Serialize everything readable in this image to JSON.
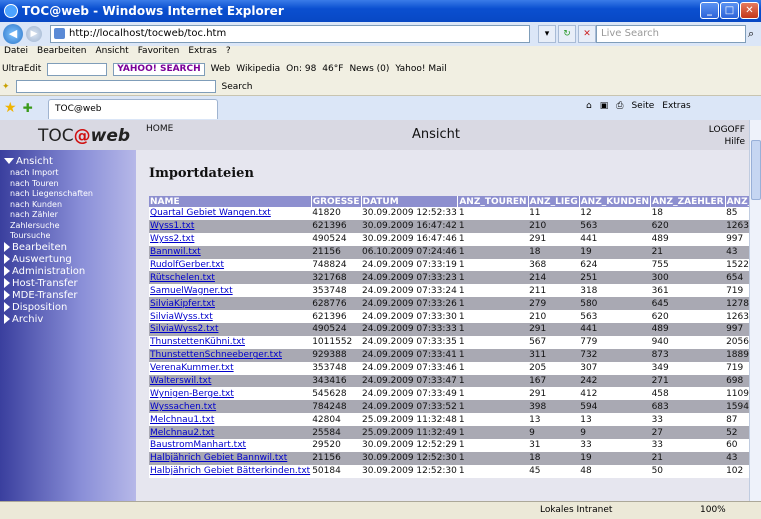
{
  "window": {
    "title": "TOC@web - Windows Internet Explorer"
  },
  "address": {
    "url": "http://localhost/tocweb/toc.htm",
    "search_placeholder": "Live Search"
  },
  "menu": [
    "Datei",
    "Bearbeiten",
    "Ansicht",
    "Favoriten",
    "Extras",
    "?"
  ],
  "toolbar": {
    "ultraedit": "UltraEdit",
    "yahoo": "YAHOO! SEARCH",
    "web": "Web",
    "wikipedia": "Wikipedia",
    "on98": "On: 98",
    "weather": "46°F",
    "news": "News (0)",
    "yahoomail": "Yahoo! Mail",
    "search": "Search"
  },
  "tabs": {
    "active": "TOC@web",
    "seite": "Seite",
    "extras": "Extras"
  },
  "app": {
    "logo_toc": "TOC",
    "logo_at": "@",
    "logo_web": "web",
    "home": "HOME",
    "view_title": "Ansicht",
    "logoff": "LOGOFF",
    "hilfe": "Hilfe"
  },
  "sidebar": {
    "ansicht": "Ansicht",
    "sub": [
      "nach Import",
      "nach Touren",
      "nach Liegenschaften",
      "nach Kunden",
      "nach Zähler",
      "Zahlersuche",
      "Toursuche"
    ],
    "sections": [
      "Bearbeiten",
      "Auswertung",
      "Administration",
      "Host-Transfer",
      "MDE-Transfer",
      "Disposition",
      "Archiv"
    ]
  },
  "content": {
    "title": "Importdateien",
    "columns": [
      "NAME",
      "GROESSE",
      "DATUM",
      "ANZ_TOUREN",
      "ANZ_LIEG",
      "ANZ_KUNDEN",
      "ANZ_ZAEHLER",
      "ANZ_ZWS"
    ],
    "rows": [
      [
        "Quartal Gebiet Wangen.txt",
        "41820",
        "30.09.2009 12:52:33",
        "1",
        "11",
        "12",
        "18",
        "85"
      ],
      [
        "Wyss1.txt",
        "621396",
        "30.09.2009 16:47:42",
        "1",
        "210",
        "563",
        "620",
        "1263"
      ],
      [
        "Wyss2.txt",
        "490524",
        "30.09.2009 16:47:46",
        "1",
        "291",
        "441",
        "489",
        "997"
      ],
      [
        "Bannwil.txt",
        "21156",
        "06.10.2009 07:24:46",
        "1",
        "18",
        "19",
        "21",
        "43"
      ],
      [
        "RudolfGerber.txt",
        "748824",
        "24.09.2009 07:33:19",
        "1",
        "368",
        "624",
        "755",
        "1522"
      ],
      [
        "Rütschelen.txt",
        "321768",
        "24.09.2009 07:33:23",
        "1",
        "214",
        "251",
        "300",
        "654"
      ],
      [
        "SamuelWagner.txt",
        "353748",
        "24.09.2009 07:33:24",
        "1",
        "211",
        "318",
        "361",
        "719"
      ],
      [
        "SilviaKipfer.txt",
        "628776",
        "24.09.2009 07:33:26",
        "1",
        "279",
        "580",
        "645",
        "1278"
      ],
      [
        "SilviaWyss.txt",
        "621396",
        "24.09.2009 07:33:30",
        "1",
        "210",
        "563",
        "620",
        "1263"
      ],
      [
        "SilviaWyss2.txt",
        "490524",
        "24.09.2009 07:33:33",
        "1",
        "291",
        "441",
        "489",
        "997"
      ],
      [
        "ThunstettenKühni.txt",
        "1011552",
        "24.09.2009 07:33:35",
        "1",
        "567",
        "779",
        "940",
        "2056"
      ],
      [
        "ThunstettenSchneeberger.txt",
        "929388",
        "24.09.2009 07:33:41",
        "1",
        "311",
        "732",
        "873",
        "1889"
      ],
      [
        "VerenaKummer.txt",
        "353748",
        "24.09.2009 07:33:46",
        "1",
        "205",
        "307",
        "349",
        "719"
      ],
      [
        "Walterswil.txt",
        "343416",
        "24.09.2009 07:33:47",
        "1",
        "167",
        "242",
        "271",
        "698"
      ],
      [
        "Wynigen-Berge.txt",
        "545628",
        "24.09.2009 07:33:49",
        "1",
        "291",
        "412",
        "458",
        "1109"
      ],
      [
        "Wyssachen.txt",
        "784248",
        "24.09.2009 07:33:52",
        "1",
        "398",
        "594",
        "683",
        "1594"
      ],
      [
        "Melchnau1.txt",
        "42804",
        "25.09.2009 11:32:48",
        "1",
        "13",
        "13",
        "33",
        "87"
      ],
      [
        "Melchnau2.txt",
        "25584",
        "25.09.2009 11:32:49",
        "1",
        "9",
        "9",
        "27",
        "52"
      ],
      [
        "BaustromManhart.txt",
        "29520",
        "30.09.2009 12:52:29",
        "1",
        "31",
        "33",
        "33",
        "60"
      ],
      [
        "Halbjährich Gebiet Bannwil.txt",
        "21156",
        "30.09.2009 12:52:30",
        "1",
        "18",
        "19",
        "21",
        "43"
      ],
      [
        "Halbjährich Gebiet Bätterkinden.txt",
        "50184",
        "30.09.2009 12:52:30",
        "1",
        "45",
        "48",
        "50",
        "102"
      ]
    ]
  },
  "status": {
    "zone": "Lokales Intranet",
    "zoom": "100%"
  }
}
